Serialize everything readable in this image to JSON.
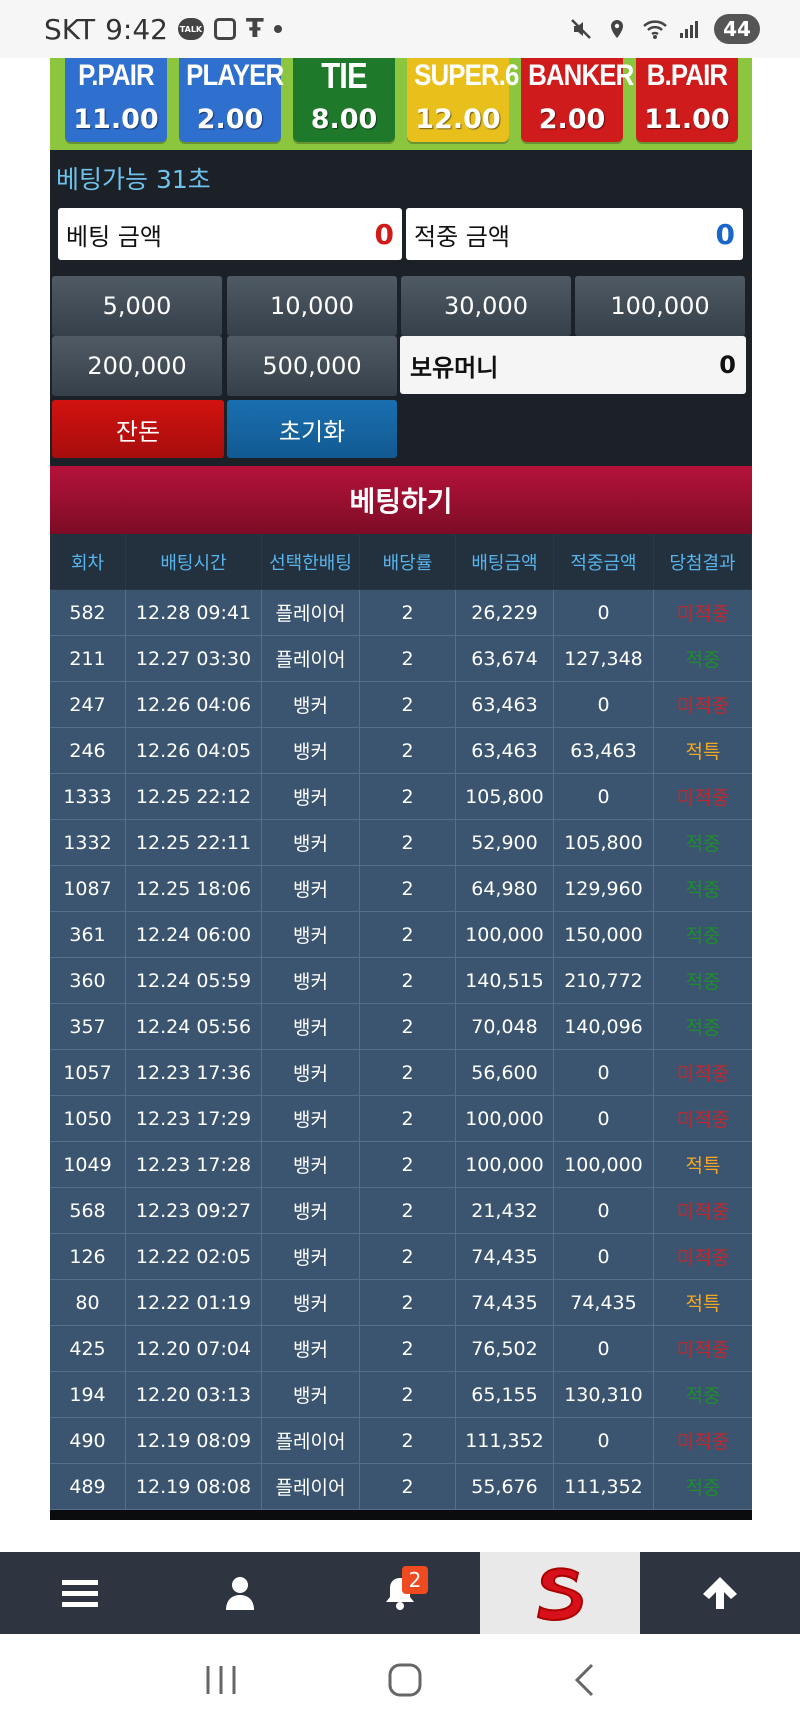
{
  "status_bar": {
    "carrier": "SKT",
    "time": "9:42",
    "talk_badge": "TALK",
    "tt_icon": "T̶T",
    "battery": "44",
    "icons": [
      "kakaotalk-icon",
      "screenshot-icon",
      "tt-icon",
      "mute-icon",
      "location-icon",
      "wifi-icon",
      "signal-icon"
    ]
  },
  "odds": [
    {
      "name": "P.PAIR",
      "value": "11.00"
    },
    {
      "name": "PLAYER",
      "value": "2.00"
    },
    {
      "name": "TIE",
      "value": "8.00"
    },
    {
      "name": "SUPER.6",
      "value": "12.00"
    },
    {
      "name": "BANKER",
      "value": "2.00"
    },
    {
      "name": "B.PAIR",
      "value": "11.00"
    }
  ],
  "timer": "베팅가능 31초",
  "bet_amount": {
    "label": "베팅 금액",
    "value": "0"
  },
  "win_amount": {
    "label": "적중 금액",
    "value": "0"
  },
  "chips": [
    "5,000",
    "10,000",
    "30,000",
    "100,000",
    "200,000",
    "500,000"
  ],
  "holding": {
    "label": "보유머니",
    "value": "0"
  },
  "buttons": {
    "change": "잔돈",
    "reset": "초기화",
    "bet": "베팅하기"
  },
  "history": {
    "headers": [
      "회차",
      "배팅시간",
      "선택한배팅",
      "배당률",
      "배팅금액",
      "적중금액",
      "당첨결과"
    ],
    "rows": [
      [
        "582",
        "12.28 09:41",
        "플레이어",
        "2",
        "26,229",
        "0",
        "미적중"
      ],
      [
        "211",
        "12.27 03:30",
        "플레이어",
        "2",
        "63,674",
        "127,348",
        "적중"
      ],
      [
        "247",
        "12.26 04:06",
        "뱅커",
        "2",
        "63,463",
        "0",
        "미적중"
      ],
      [
        "246",
        "12.26 04:05",
        "뱅커",
        "2",
        "63,463",
        "63,463",
        "적특"
      ],
      [
        "1333",
        "12.25 22:12",
        "뱅커",
        "2",
        "105,800",
        "0",
        "미적중"
      ],
      [
        "1332",
        "12.25 22:11",
        "뱅커",
        "2",
        "52,900",
        "105,800",
        "적중"
      ],
      [
        "1087",
        "12.25 18:06",
        "뱅커",
        "2",
        "64,980",
        "129,960",
        "적중"
      ],
      [
        "361",
        "12.24 06:00",
        "뱅커",
        "2",
        "100,000",
        "150,000",
        "적중"
      ],
      [
        "360",
        "12.24 05:59",
        "뱅커",
        "2",
        "140,515",
        "210,772",
        "적중"
      ],
      [
        "357",
        "12.24 05:56",
        "뱅커",
        "2",
        "70,048",
        "140,096",
        "적중"
      ],
      [
        "1057",
        "12.23 17:36",
        "뱅커",
        "2",
        "56,600",
        "0",
        "미적중"
      ],
      [
        "1050",
        "12.23 17:29",
        "뱅커",
        "2",
        "100,000",
        "0",
        "미적중"
      ],
      [
        "1049",
        "12.23 17:28",
        "뱅커",
        "2",
        "100,000",
        "100,000",
        "적특"
      ],
      [
        "568",
        "12.23 09:27",
        "뱅커",
        "2",
        "21,432",
        "0",
        "미적중"
      ],
      [
        "126",
        "12.22 02:05",
        "뱅커",
        "2",
        "74,435",
        "0",
        "미적중"
      ],
      [
        "80",
        "12.22 01:19",
        "뱅커",
        "2",
        "74,435",
        "74,435",
        "적특"
      ],
      [
        "425",
        "12.20 07:04",
        "뱅커",
        "2",
        "76,502",
        "0",
        "미적중"
      ],
      [
        "194",
        "12.20 03:13",
        "뱅커",
        "2",
        "65,155",
        "130,310",
        "적중"
      ],
      [
        "490",
        "12.19 08:09",
        "플레이어",
        "2",
        "111,352",
        "0",
        "미적중"
      ],
      [
        "489",
        "12.19 08:08",
        "플레이어",
        "2",
        "55,676",
        "111,352",
        "적중"
      ]
    ]
  },
  "bottom_nav": {
    "items": [
      "menu-icon",
      "user-icon",
      "bell-icon",
      "logo",
      "arrow-up-icon"
    ],
    "notification_count": "2"
  },
  "colors": {
    "bg_dark": "#1c2127",
    "history_row": "#3b5570",
    "bet_button": "#9b0f2f",
    "lose": "#c1272d",
    "win": "#1c8f2c",
    "tie": "#f5a623"
  }
}
